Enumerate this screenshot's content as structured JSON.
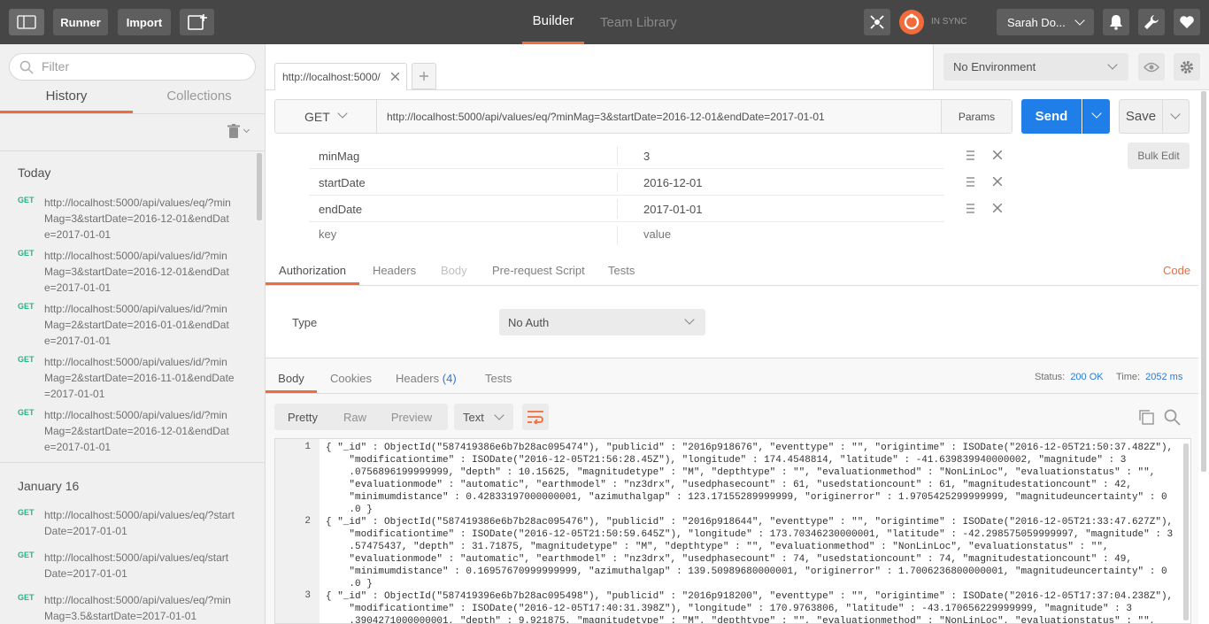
{
  "topbar": {
    "runner": "Runner",
    "import": "Import",
    "tabs": {
      "builder": "Builder",
      "team_library": "Team Library"
    },
    "sync_status": "IN SYNC",
    "user": "Sarah Do...",
    "colors": {
      "bg": "#464646",
      "accent": "#f26b3a"
    }
  },
  "sidebar": {
    "filter_placeholder": "Filter",
    "tabs": {
      "history": "History",
      "collections": "Collections"
    },
    "groups": [
      {
        "label": "Today",
        "items": [
          {
            "method": "GET",
            "url": "http://localhost:5000/api/values/eq/?minMag=3&startDate=2016-12-01&endDate=2017-01-01"
          },
          {
            "method": "GET",
            "url": "http://localhost:5000/api/values/id/?minMag=3&startDate=2016-12-01&endDate=2017-01-01"
          },
          {
            "method": "GET",
            "url": "http://localhost:5000/api/values/id/?minMag=2&startDate=2016-01-01&endDate=2017-01-01"
          },
          {
            "method": "GET",
            "url": "http://localhost:5000/api/values/id/?minMag=2&startDate=2016-11-01&endDate=2017-01-01"
          },
          {
            "method": "GET",
            "url": "http://localhost:5000/api/values/id/?minMag=2&startDate=2016-12-01&endDate=2017-01-01"
          }
        ]
      },
      {
        "label": "January 16",
        "items": [
          {
            "method": "GET",
            "url": "http://localhost:5000/api/values/eq/?startDate=2017-01-01"
          },
          {
            "method": "GET",
            "url": "http://localhost:5000/api/values/eq/startDate=2017-01-01"
          },
          {
            "method": "GET",
            "url": "http://localhost:5000/api/values/eq/?minMag=3.5&startDate=2017-01-01"
          }
        ]
      }
    ]
  },
  "request": {
    "tab_label": "http://localhost:5000/",
    "environment": "No Environment",
    "method": "GET",
    "url": "http://localhost:5000/api/values/eq/?minMag=3&startDate=2016-12-01&endDate=2017-01-01",
    "params_label": "Params",
    "send_label": "Send",
    "save_label": "Save",
    "bulk_edit": "Bulk Edit",
    "params": [
      {
        "key": "minMag",
        "value": "3"
      },
      {
        "key": "startDate",
        "value": "2016-12-01"
      },
      {
        "key": "endDate",
        "value": "2017-01-01"
      }
    ],
    "key_placeholder": "key",
    "value_placeholder": "value",
    "subtabs": {
      "authorization": "Authorization",
      "headers": "Headers",
      "body": "Body",
      "pre_request": "Pre-request Script",
      "tests": "Tests",
      "code": "Code"
    },
    "auth_type_label": "Type",
    "auth_value": "No Auth"
  },
  "response": {
    "tabs": {
      "body": "Body",
      "cookies": "Cookies",
      "headers": "Headers",
      "headers_count": "(4)",
      "tests": "Tests"
    },
    "status_label": "Status:",
    "status_value": "200 OK",
    "time_label": "Time:",
    "time_value": "2052 ms",
    "view_modes": {
      "pretty": "Pretty",
      "raw": "Raw",
      "preview": "Preview"
    },
    "format": "Text",
    "lines": [
      {
        "num": "1",
        "text": [
          "{ \"_id\" : ObjectId(\"587419386e6b7b28ac095474\"), \"publicid\" : \"2016p918676\", \"eventtype\" : \"\", \"origintime\" : ISODate(\"2016-12-05T21:50:37.482Z\"),",
          "    \"modificationtime\" : ISODate(\"2016-12-05T21:56:28.45Z\"), \"longitude\" : 174.4548814, \"latitude\" : -41.639839940000002, \"magnitude\" : 3",
          "    .0756896199999999, \"depth\" : 10.15625, \"magnitudetype\" : \"M\", \"depthtype\" : \"\", \"evaluationmethod\" : \"NonLinLoc\", \"evaluationstatus\" : \"\",",
          "    \"evaluationmode\" : \"automatic\", \"earthmodel\" : \"nz3drx\", \"usedphasecount\" : 61, \"usedstationcount\" : 61, \"magnitudestationcount\" : 42,",
          "    \"minimumdistance\" : 0.42833197000000001, \"azimuthalgap\" : 123.17155289999999, \"originerror\" : 1.9705425299999999, \"magnitudeuncertainty\" : 0",
          "    .0 }"
        ]
      },
      {
        "num": "2",
        "text": [
          "{ \"_id\" : ObjectId(\"587419386e6b7b28ac095476\"), \"publicid\" : \"2016p918644\", \"eventtype\" : \"\", \"origintime\" : ISODate(\"2016-12-05T21:33:47.627Z\"),",
          "    \"modificationtime\" : ISODate(\"2016-12-05T21:50:59.645Z\"), \"longitude\" : 173.70346230000001, \"latitude\" : -42.298575059999997, \"magnitude\" : 3",
          "    .57475437, \"depth\" : 31.71875, \"magnitudetype\" : \"M\", \"depthtype\" : \"\", \"evaluationmethod\" : \"NonLinLoc\", \"evaluationstatus\" : \"\",",
          "    \"evaluationmode\" : \"automatic\", \"earthmodel\" : \"nz3drx\", \"usedphasecount\" : 74, \"usedstationcount\" : 74, \"magnitudestationcount\" : 49,",
          "    \"minimumdistance\" : 0.16957670999999999, \"azimuthalgap\" : 139.50989680000001, \"originerror\" : 1.7006236800000001, \"magnitudeuncertainty\" : 0",
          "    .0 }"
        ]
      },
      {
        "num": "3",
        "text": [
          "{ \"_id\" : ObjectId(\"587419396e6b7b28ac095498\"), \"publicid\" : \"2016p918200\", \"eventtype\" : \"\", \"origintime\" : ISODate(\"2016-12-05T17:37:04.238Z\"),",
          "    \"modificationtime\" : ISODate(\"2016-12-05T17:40:31.398Z\"), \"longitude\" : 170.9763806, \"latitude\" : -43.170656229999999, \"magnitude\" : 3",
          "    .3904271000000001, \"depth\" : 9.921875, \"magnitudetype\" : \"M\", \"depthtype\" : \"\", \"evaluationmethod\" : \"NonLinLoc\", \"evaluationstatus\" : \"\","
        ]
      }
    ]
  },
  "colors": {
    "orange": "#f26b3a",
    "blue": "#1f7ee8",
    "green": "#26b47f",
    "link": "#2a7ad6"
  }
}
